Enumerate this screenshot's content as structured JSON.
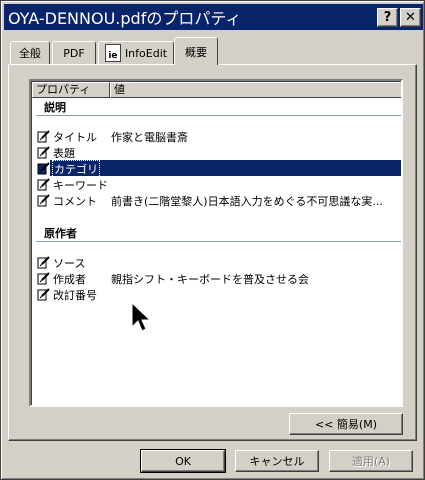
{
  "window": {
    "title": "OYA-DENNOU.pdfのプロパティ",
    "help_button": "?",
    "close_button": "✕"
  },
  "tabs": [
    "全般",
    "PDF",
    "InfoEdit",
    "概要"
  ],
  "tab_icons": {
    "infoedit": "ie-icon"
  },
  "active_tab": "概要",
  "listview": {
    "columns": [
      "プロパティ",
      "値"
    ],
    "groups": [
      {
        "label": "説明",
        "rows": [
          {
            "name": "タイトル",
            "value": "作家と電脳書斎"
          },
          {
            "name": "表題",
            "value": ""
          },
          {
            "name": "カテゴリ",
            "value": "",
            "selected": true
          },
          {
            "name": "キーワード",
            "value": ""
          },
          {
            "name": "コメント",
            "value": "前書き(二階堂黎人)日本語入力をめぐる不可思議な実..."
          }
        ]
      },
      {
        "label": "原作者",
        "rows": [
          {
            "name": "ソース",
            "value": ""
          },
          {
            "name": "作成者",
            "value": "親指シフト・キーボードを普及させる会"
          },
          {
            "name": "改訂番号",
            "value": ""
          }
        ]
      }
    ],
    "row_icon": "edit-property-icon"
  },
  "buttons": {
    "simple": "<< 簡易(M)",
    "ok": "OK",
    "cancel": "キャンセル",
    "apply": "適用(A)"
  },
  "colors": {
    "titlebar": "#0a246a",
    "selection": "#0a246a",
    "group_line": "#7fa3c8",
    "face": "#d4d0c8"
  }
}
